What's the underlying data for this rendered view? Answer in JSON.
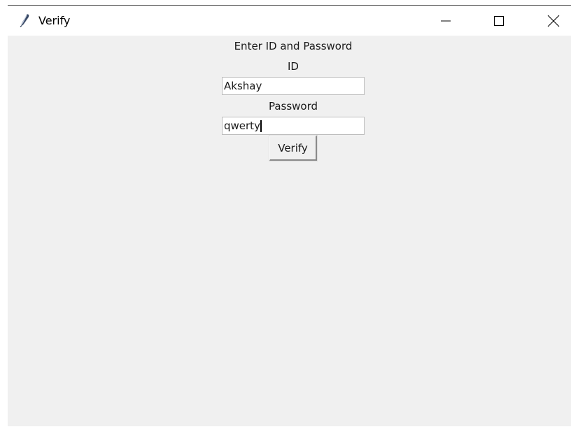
{
  "window": {
    "title": "Verify",
    "controls": {
      "minimize": "minimize-icon",
      "maximize": "maximize-icon",
      "close": "close-icon"
    },
    "app_icon": "feather-icon"
  },
  "form": {
    "heading": "Enter ID and Password",
    "id_label": "ID",
    "id_value": "Akshay",
    "password_label": "Password",
    "password_value": "qwerty",
    "verify_button": "Verify"
  },
  "colors": {
    "background": "#f0f0f0",
    "titlebar": "#ffffff",
    "entry_background": "#ffffff"
  }
}
